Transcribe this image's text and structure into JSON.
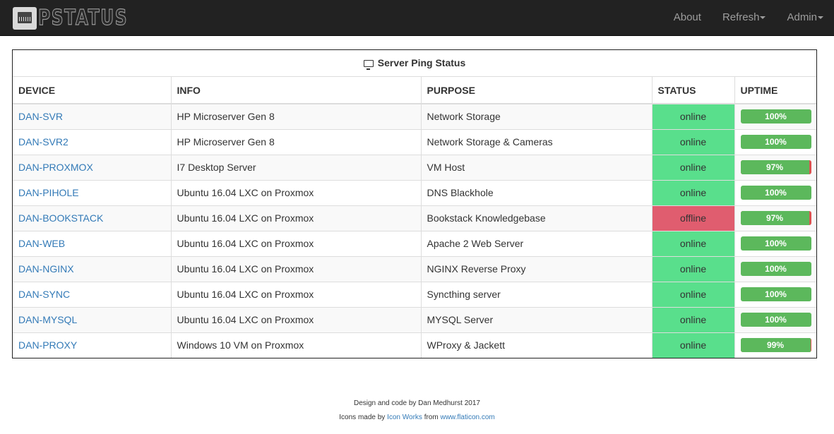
{
  "app": {
    "brand_text": "PSTATUS"
  },
  "nav": {
    "about": "About",
    "refresh": "Refresh",
    "admin": "Admin"
  },
  "table": {
    "caption": "Server Ping Status",
    "headers": [
      "DEVICE",
      "INFO",
      "PURPOSE",
      "STATUS",
      "UPTIME"
    ],
    "rows": [
      {
        "device": "DAN-SVR",
        "info": "HP Microserver Gen 8",
        "purpose": "Network Storage",
        "status": "online",
        "uptime": "100%",
        "uptime_value": 100
      },
      {
        "device": "DAN-SVR2",
        "info": "HP Microserver Gen 8",
        "purpose": "Network Storage & Cameras",
        "status": "online",
        "uptime": "100%",
        "uptime_value": 100
      },
      {
        "device": "DAN-PROXMOX",
        "info": "I7 Desktop Server",
        "purpose": "VM Host",
        "status": "online",
        "uptime": "97%",
        "uptime_value": 97
      },
      {
        "device": "DAN-PIHOLE",
        "info": "Ubuntu 16.04 LXC on Proxmox",
        "purpose": "DNS Blackhole",
        "status": "online",
        "uptime": "100%",
        "uptime_value": 100
      },
      {
        "device": "DAN-BOOKSTACK",
        "info": "Ubuntu 16.04 LXC on Proxmox",
        "purpose": "Bookstack Knowledgebase",
        "status": "offline",
        "uptime": "97%",
        "uptime_value": 97
      },
      {
        "device": "DAN-WEB",
        "info": "Ubuntu 16.04 LXC on Proxmox",
        "purpose": "Apache 2 Web Server",
        "status": "online",
        "uptime": "100%",
        "uptime_value": 100
      },
      {
        "device": "DAN-NGINX",
        "info": "Ubuntu 16.04 LXC on Proxmox",
        "purpose": "NGINX Reverse Proxy",
        "status": "online",
        "uptime": "100%",
        "uptime_value": 100
      },
      {
        "device": "DAN-SYNC",
        "info": "Ubuntu 16.04 LXC on Proxmox",
        "purpose": "Syncthing server",
        "status": "online",
        "uptime": "100%",
        "uptime_value": 100
      },
      {
        "device": "DAN-MYSQL",
        "info": "Ubuntu 16.04 LXC on Proxmox",
        "purpose": "MYSQL Server",
        "status": "online",
        "uptime": "100%",
        "uptime_value": 100
      },
      {
        "device": "DAN-PROXY",
        "info": "Windows 10 VM on Proxmox",
        "purpose": "WProxy & Jackett",
        "status": "online",
        "uptime": "99%",
        "uptime_value": 99
      }
    ]
  },
  "footer": {
    "line1": "Design and code by Dan Medhurst 2017",
    "icons_prefix": "Icons made by ",
    "icons_author": "Icon Works",
    "icons_from": " from ",
    "icons_site": "www.flaticon.com"
  },
  "colors": {
    "navbar": "#222222",
    "online": "#59df8c",
    "offline": "#e05d6f",
    "bar_success": "#5cb85c",
    "bar_danger": "#d9534f",
    "link": "#337ab7"
  },
  "icons": {
    "brand": "network-port-icon",
    "caption": "monitor-icon"
  }
}
